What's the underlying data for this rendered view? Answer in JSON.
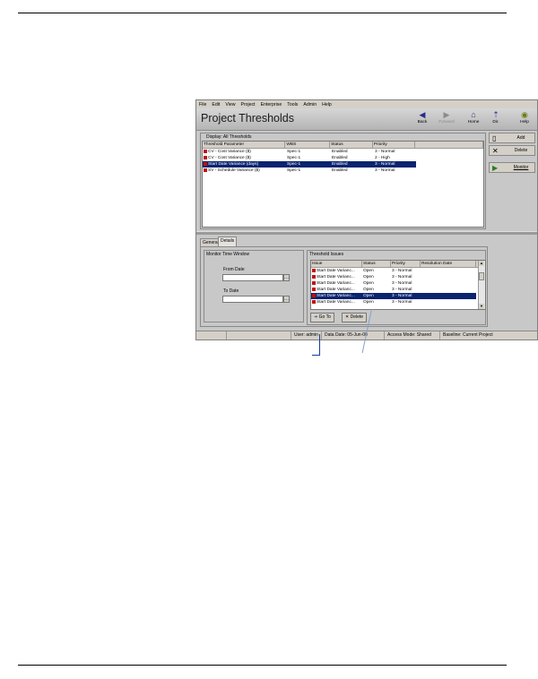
{
  "menu": [
    "File",
    "Edit",
    "View",
    "Project",
    "Enterprise",
    "Tools",
    "Admin",
    "Help"
  ],
  "title": "Project Thresholds",
  "nav": [
    {
      "label": "Back",
      "icon": "back-arrow-icon"
    },
    {
      "label": "Forward",
      "icon": "forward-arrow-icon"
    },
    {
      "label": "Home",
      "icon": "home-icon"
    },
    {
      "label": "Dir.",
      "icon": "directory-icon"
    },
    {
      "label": "Help",
      "icon": "help-icon"
    }
  ],
  "actions": {
    "add": "Add",
    "delete": "Delete",
    "monitor": "Monitor"
  },
  "display_label": "Display: All Thresholds",
  "thresholds": {
    "columns": [
      "Threshold Parameter",
      "WBS",
      "Status",
      "Priority"
    ],
    "rows": [
      {
        "parameter": "CV - Cost Variance ($)",
        "wbs": "Spec-1",
        "status": "Enabled",
        "priority": "3 - Normal",
        "selected": false
      },
      {
        "parameter": "CV - Cost Variance ($)",
        "wbs": "Spec-1",
        "status": "Enabled",
        "priority": "2 - High",
        "selected": false
      },
      {
        "parameter": "Start Date Variance (days)",
        "wbs": "Spec-1",
        "status": "Enabled",
        "priority": "3 - Normal",
        "selected": true
      },
      {
        "parameter": "SV - Schedule Variance ($)",
        "wbs": "Spec-1",
        "status": "Enabled",
        "priority": "3 - Normal",
        "selected": false
      }
    ]
  },
  "tabs": [
    "General",
    "Details"
  ],
  "monitor_window": {
    "title": "Monitor Time Window",
    "from_label": "From Date",
    "to_label": "To Date",
    "from_value": "",
    "to_value": ""
  },
  "issues": {
    "title": "Threshold Issues",
    "columns": [
      "Issue",
      "Status",
      "Priority",
      "Resolution Date"
    ],
    "rows": [
      {
        "issue": "Start Date Varianc...",
        "status": "Open",
        "priority": "3 - Normal",
        "resolution": "",
        "selected": false
      },
      {
        "issue": "Start Date Varianc...",
        "status": "Open",
        "priority": "3 - Normal",
        "resolution": "",
        "selected": false
      },
      {
        "issue": "Start Date Varianc...",
        "status": "Open",
        "priority": "3 - Normal",
        "resolution": "",
        "selected": false
      },
      {
        "issue": "Start Date Varianc...",
        "status": "Open",
        "priority": "3 - Normal",
        "resolution": "",
        "selected": false
      },
      {
        "issue": "Start Date Varianc...",
        "status": "Open",
        "priority": "3 - Normal",
        "resolution": "",
        "selected": true
      },
      {
        "issue": "Start Date Varianc...",
        "status": "Open",
        "priority": "3 - Normal",
        "resolution": "",
        "selected": false
      }
    ],
    "goto_label": "Go To",
    "delete_label": "Delete"
  },
  "status": {
    "user": "User: admin",
    "data_date": "Data Date: 05-Jun-00",
    "access": "Access Mode: Shared",
    "baseline": "Baseline: Current Project"
  },
  "colors": {
    "selection": "#0a2470",
    "callout": "#1a3a9a",
    "flag_red": "#c01010"
  }
}
